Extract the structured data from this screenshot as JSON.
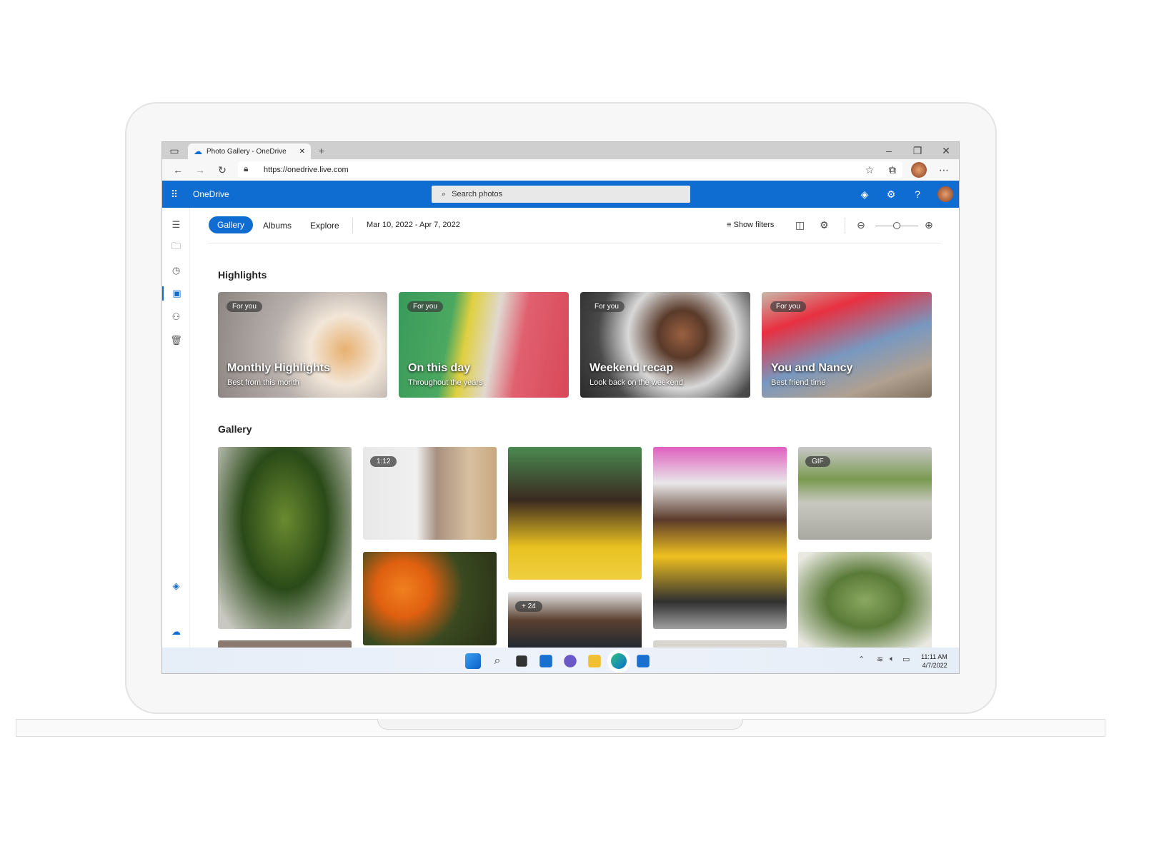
{
  "browser": {
    "tab_title": "Photo Gallery - OneDrive",
    "url": "https://onedrive.live.com"
  },
  "header": {
    "app_name": "OneDrive",
    "search_placeholder": "Search photos"
  },
  "toolbar": {
    "tabs": [
      {
        "label": "Gallery",
        "active": true
      },
      {
        "label": "Albums"
      },
      {
        "label": "Explore"
      }
    ],
    "date_range": "Mar 10, 2022 - Apr 7, 2022",
    "show_filters": "Show filters"
  },
  "highlights": {
    "heading": "Highlights",
    "cards": [
      {
        "badge": "For you",
        "title": "Monthly Highlights",
        "subtitle": "Best from this month"
      },
      {
        "badge": "For you",
        "title": "On this day",
        "subtitle": "Throughout the years"
      },
      {
        "badge": "For you",
        "title": "Weekend recap",
        "subtitle": "Look back on the weekend"
      },
      {
        "badge": "For you",
        "title": "You and Nancy",
        "subtitle": "Best friend time"
      }
    ]
  },
  "gallery": {
    "heading": "Gallery",
    "badges": {
      "cat": "1:12",
      "skater": "GIF",
      "woman": "+ 24"
    }
  },
  "taskbar": {
    "time": "11:11 AM",
    "date": "4/7/2022"
  },
  "colors": {
    "accent": "#0f6cd0"
  }
}
